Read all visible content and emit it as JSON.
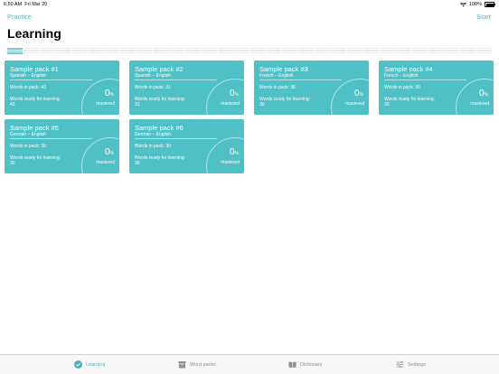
{
  "status_bar": {
    "time": "6:50 AM",
    "date": "Fri Mar 20",
    "battery": "100%"
  },
  "nav": {
    "left_label": "Practice",
    "right_label": "Start"
  },
  "page_title": "Learning",
  "colors": {
    "accent": "#4fb3be",
    "card": "#4fc0c6",
    "inactive": "#8e8e93"
  },
  "packs": [
    {
      "name": "Sample pack #1",
      "languages": "Spanish – English",
      "words_in_pack": "Words in pack: 43",
      "ready_label": "Words ready for learning: 43",
      "percent": "0",
      "percent_unit": "%",
      "mastered_label": "mastered"
    },
    {
      "name": "Sample pack #2",
      "languages": "Spanish – English",
      "words_in_pack": "Words in pack: 31",
      "ready_label": "Words ready for learning: 31",
      "percent": "0",
      "percent_unit": "%",
      "mastered_label": "mastered"
    },
    {
      "name": "Sample pack #3",
      "languages": "French – English",
      "words_in_pack": "Words in pack: 30",
      "ready_label": "Words ready for learning: 30",
      "percent": "0",
      "percent_unit": "%",
      "mastered_label": "mastered"
    },
    {
      "name": "Sample pack #4",
      "languages": "French – English",
      "words_in_pack": "Words in pack: 30",
      "ready_label": "Words ready for learning: 30",
      "percent": "0",
      "percent_unit": "%",
      "mastered_label": "mastered"
    },
    {
      "name": "Sample pack #5",
      "languages": "German – English",
      "words_in_pack": "Words in pack: 30",
      "ready_label": "Words ready for learning: 30",
      "percent": "0",
      "percent_unit": "%",
      "mastered_label": "mastered"
    },
    {
      "name": "Sample pack #6",
      "languages": "German – English",
      "words_in_pack": "Words in pack: 30",
      "ready_label": "Words ready for learning: 30",
      "percent": "0",
      "percent_unit": "%",
      "mastered_label": "mastered"
    }
  ],
  "tabs": [
    {
      "label": "Learning",
      "icon": "checkmark-circle-icon",
      "active": true
    },
    {
      "label": "Word packs",
      "icon": "archive-box-icon",
      "active": false
    },
    {
      "label": "Dictionary",
      "icon": "open-book-icon",
      "active": false
    },
    {
      "label": "Settings",
      "icon": "sliders-icon",
      "active": false
    }
  ]
}
